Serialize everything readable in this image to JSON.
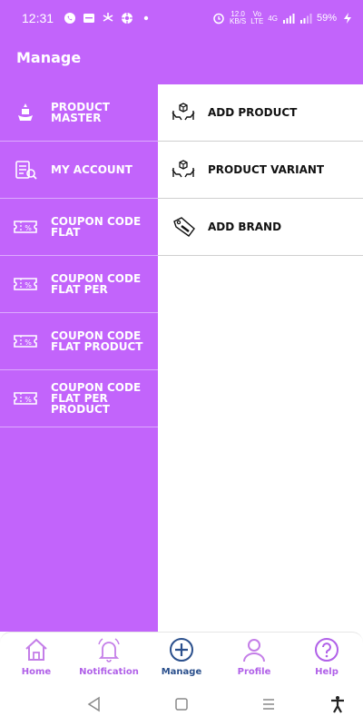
{
  "status_bar": {
    "time": "12:31",
    "net_speed_value": "12.0",
    "net_speed_unit": "KB/S",
    "volte_top": "Vo",
    "volte_bottom": "LTE",
    "network": "4G",
    "battery": "59%",
    "icons": [
      "whatsapp-icon",
      "message-icon",
      "fan-icon",
      "app-icon",
      "dot-icon",
      "alarm-icon",
      "signal-icon",
      "battery-icon",
      "charging-icon"
    ]
  },
  "header": {
    "title": "Manage"
  },
  "sidebar": {
    "items": [
      {
        "label": "PRODUCT MASTER",
        "icon": "product-master-icon"
      },
      {
        "label": "MY ACCOUNT",
        "icon": "account-icon"
      },
      {
        "label": "COUPON CODE FLAT",
        "icon": "coupon-icon"
      },
      {
        "label": "COUPON CODE FLAT PER",
        "icon": "coupon-icon"
      },
      {
        "label": "COUPON CODE FLAT PRODUCT",
        "icon": "coupon-icon"
      },
      {
        "label": "COUPON CODE FLAT PER PRODUCT",
        "icon": "coupon-icon"
      }
    ]
  },
  "sub_menu": {
    "items": [
      {
        "label": "ADD PRODUCT",
        "icon": "box-hands-icon"
      },
      {
        "label": "PRODUCT VARIANT",
        "icon": "box-hands-icon"
      },
      {
        "label": "ADD BRAND",
        "icon": "brand-tag-icon"
      }
    ]
  },
  "bottom_nav": {
    "items": [
      {
        "label": "Home",
        "icon": "home-icon",
        "active": false
      },
      {
        "label": "Notification",
        "icon": "bell-icon",
        "active": false
      },
      {
        "label": "Manage",
        "icon": "plus-circle-icon",
        "active": true
      },
      {
        "label": "Profile",
        "icon": "user-icon",
        "active": false
      },
      {
        "label": "Help",
        "icon": "help-icon",
        "active": false
      }
    ]
  },
  "colors": {
    "primary": "#c264fb",
    "nav_inactive": "#b060e8",
    "nav_active": "#2a4f8c"
  }
}
